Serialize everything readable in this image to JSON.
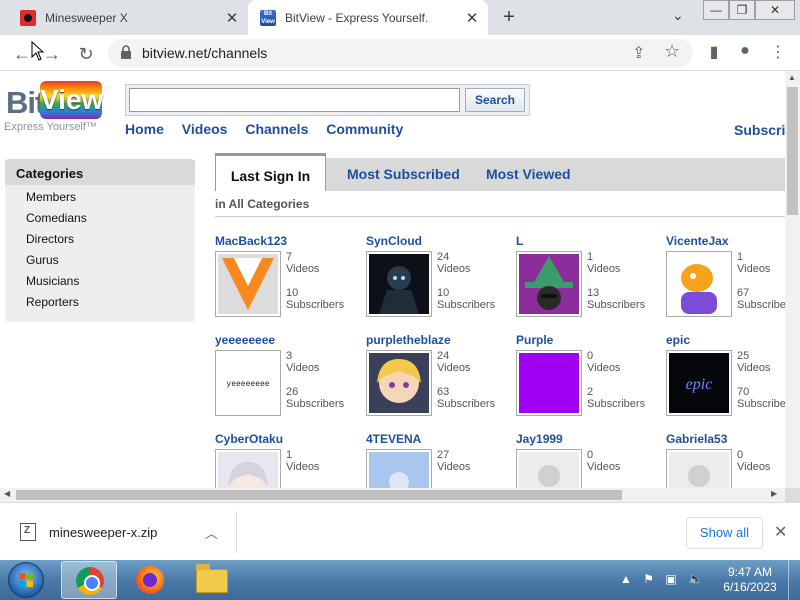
{
  "browser": {
    "tabs": [
      {
        "title": "Minesweeper X",
        "active": false
      },
      {
        "title": "BitView - Express Yourself.",
        "active": true
      }
    ],
    "url": "bitview.net/channels",
    "bitview_favicon_text": "Bit View"
  },
  "site": {
    "logo": {
      "bit": "Bit",
      "view": "View",
      "tagline": "Express Yourself™"
    },
    "search": {
      "button_label": "Search",
      "query": ""
    },
    "nav": [
      "Home",
      "Videos",
      "Channels",
      "Community"
    ],
    "nav_right": "Subscri",
    "sidebar": {
      "heading": "Categories",
      "items": [
        "Members",
        "Comedians",
        "Directors",
        "Gurus",
        "Musicians",
        "Reporters"
      ]
    },
    "channel_tabs": [
      "Last Sign In",
      "Most Subscribed",
      "Most Viewed"
    ],
    "active_tab": "Last Sign In",
    "filter_label": "in All Categories",
    "channels": [
      {
        "name": "MacBack123",
        "videos": "7",
        "subs": "10",
        "art": "chevron"
      },
      {
        "name": "SynCloud",
        "videos": "24",
        "subs": "10",
        "art": "dark"
      },
      {
        "name": "L",
        "videos": "1",
        "subs": "13",
        "art": "witch"
      },
      {
        "name": "VicenteJax",
        "videos": "1",
        "subs": "67",
        "art": "cartoon"
      },
      {
        "name": "yeeeeeeee",
        "videos": "3",
        "subs": "26",
        "art": "text"
      },
      {
        "name": "purpletheblaze",
        "videos": "24",
        "subs": "63",
        "art": "anime"
      },
      {
        "name": "Purple",
        "videos": "0",
        "subs": "2",
        "art": "purple"
      },
      {
        "name": "epic",
        "videos": "25",
        "subs": "70",
        "art": "epic"
      },
      {
        "name": "CyberOtaku",
        "videos": "1",
        "subs": "",
        "art": "anime2"
      },
      {
        "name": "4TEVENA",
        "videos": "27",
        "subs": "",
        "art": "blue"
      },
      {
        "name": "Jay1999",
        "videos": "0",
        "subs": "",
        "art": "default"
      },
      {
        "name": "Gabriela53",
        "videos": "0",
        "subs": "",
        "art": "default"
      }
    ],
    "videos_label": "Videos",
    "subscribers_label": "Subscribers",
    "thumb_text_yeee": "yeeeeeeee",
    "thumb_text_epic": "epic"
  },
  "downloads": {
    "file": "minesweeper-x.zip",
    "show_all": "Show all"
  },
  "taskbar": {
    "time": "9:47 AM",
    "date": "6/16/2023"
  },
  "colors": {
    "link": "#1d4f9e",
    "accent": "#1a73e8",
    "purple_avatar": "#a100f2"
  }
}
